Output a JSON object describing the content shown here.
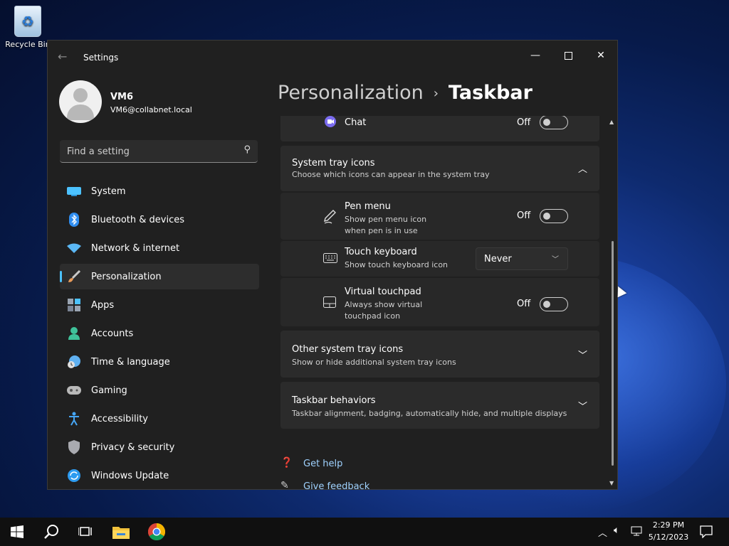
{
  "desktop": {
    "recycle_bin_label": "Recycle Bin"
  },
  "window": {
    "title": "Settings",
    "controls": {
      "minimize": "—",
      "close": "✕"
    }
  },
  "profile": {
    "name": "VM6",
    "email": "VM6@collabnet.local"
  },
  "search": {
    "placeholder": "Find a setting"
  },
  "nav": {
    "items": [
      {
        "label": "System",
        "icon": "monitor-icon",
        "color": "#4cc2ff"
      },
      {
        "label": "Bluetooth & devices",
        "icon": "bluetooth-icon",
        "color": "#2f8df0"
      },
      {
        "label": "Network & internet",
        "icon": "wifi-icon",
        "color": "#5bb8f5"
      },
      {
        "label": "Personalization",
        "icon": "brush-icon",
        "color": "#e89b5a",
        "active": true
      },
      {
        "label": "Apps",
        "icon": "apps-icon",
        "color": "#9aa4b2"
      },
      {
        "label": "Accounts",
        "icon": "person-icon",
        "color": "#3fc29a"
      },
      {
        "label": "Time & language",
        "icon": "clock-globe-icon",
        "color": "#5fb0f0"
      },
      {
        "label": "Gaming",
        "icon": "gamepad-icon",
        "color": "#b9b9b9"
      },
      {
        "label": "Accessibility",
        "icon": "accessibility-icon",
        "color": "#46a6f5"
      },
      {
        "label": "Privacy & security",
        "icon": "shield-icon",
        "color": "#a9aab0"
      },
      {
        "label": "Windows Update",
        "icon": "update-icon",
        "color": "#2d9bf0"
      }
    ]
  },
  "header": {
    "parent": "Personalization",
    "separator": "›",
    "current": "Taskbar"
  },
  "content": {
    "chat": {
      "label": "Chat",
      "state": "Off"
    },
    "system_tray": {
      "title": "System tray icons",
      "desc": "Choose which icons can appear in the system tray",
      "items": [
        {
          "title": "Pen menu",
          "desc": "Show pen menu icon when pen is in use",
          "state": "Off"
        },
        {
          "title": "Touch keyboard",
          "desc": "Show touch keyboard icon",
          "value": "Never"
        },
        {
          "title": "Virtual touchpad",
          "desc": "Always show virtual touchpad icon",
          "state": "Off"
        }
      ]
    },
    "other_tray": {
      "title": "Other system tray icons",
      "desc": "Show or hide additional system tray icons"
    },
    "behaviors": {
      "title": "Taskbar behaviors",
      "desc": "Taskbar alignment, badging, automatically hide, and multiple displays"
    },
    "links": {
      "help": "Get help",
      "feedback": "Give feedback"
    }
  },
  "taskbar": {
    "time": "2:29 PM",
    "date": "5/12/2023"
  }
}
